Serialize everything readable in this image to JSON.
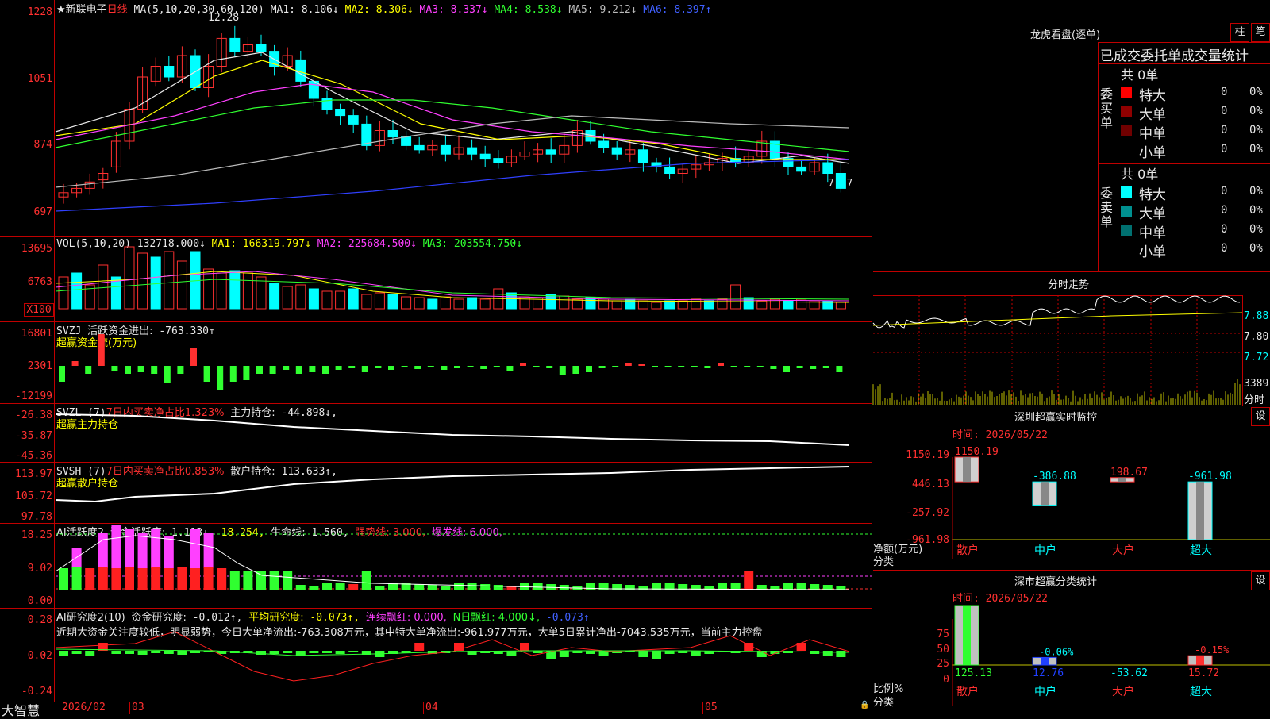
{
  "main": {
    "stock_name": "★新联电子",
    "period": "日线",
    "ma_label": "MA(5,10,20,30,60,120)",
    "ma": [
      {
        "name": "MA1:",
        "value": "8.106↓",
        "color": "#e8e8e8"
      },
      {
        "name": "MA2:",
        "value": "8.306↓",
        "color": "#ffff00"
      },
      {
        "name": "MA3:",
        "value": "8.337↓",
        "color": "#ff40ff"
      },
      {
        "name": "MA4:",
        "value": "8.538↓",
        "color": "#30ff30"
      },
      {
        "name": "MA5:",
        "value": "9.212↓",
        "color": "#bbbbbb"
      },
      {
        "name": "MA6:",
        "value": "8.397↑",
        "color": "#4060ff"
      }
    ],
    "axis": [
      "1228",
      "1051",
      "874",
      "697"
    ],
    "high_mark": "12.28",
    "low_mark": "7.77"
  },
  "vol": {
    "label": "VOL(5,10,20)",
    "value": "132718.000↓",
    "ma": [
      {
        "name": "MA1:",
        "value": "166319.797↓",
        "color": "#ffff00"
      },
      {
        "name": "MA2:",
        "value": "225684.500↓",
        "color": "#ff40ff"
      },
      {
        "name": "MA3:",
        "value": "203554.750↓",
        "color": "#30ff30"
      }
    ],
    "axis": [
      "13695",
      "6763",
      "X100"
    ]
  },
  "svzj": {
    "label": "SVZJ",
    "item": "活跃资金进出:",
    "value": "-763.330↑",
    "subtitle": "超赢资金流(万元)",
    "axis": [
      "16801",
      "2301",
      "-12199"
    ]
  },
  "svzl": {
    "label": "SVZL (7)",
    "item1": "7日内买卖净占比1.323%",
    "item2": "主力持仓:",
    "value": "-44.898↓,",
    "subtitle": "超赢主力持仓",
    "axis": [
      "-26.38",
      "-35.87",
      "-45.36"
    ]
  },
  "svsh": {
    "label": "SVSH (7)",
    "item1": "7日内买卖净占比0.853%",
    "item2": "散户持仓:",
    "value": "113.633↑,",
    "subtitle": "超赢散户持仓",
    "axis": [
      "113.97",
      "105.72",
      "97.78"
    ]
  },
  "ai1": {
    "label": "AI活跃度2",
    "item": "资金活跃度:",
    "value": "1.113↓,",
    "v2": "18.254,",
    "life_label": "生命线:",
    "life": "1.560,",
    "strong": "强势线: 3.000,",
    "burst": "爆发线: 6.000,",
    "axis": [
      "18.25",
      "9.02",
      "0.00"
    ]
  },
  "ai2": {
    "label": "AI研究度2(10)",
    "item1": "资金研究度:",
    "v1": "-0.012↑,",
    "item2": "平均研究度:",
    "v2": "-0.073↑,",
    "item3": "连续飘红: 0.000,",
    "item4": "N日飘红: 4.000↓,",
    "v5": "-0.073↑",
    "comment": "近期大资金关注度较低，明显弱势，今日大单净流出:-763.308万元，其中特大单净流出:-961.977万元，大单5日累计净出-7043.535万元，当前主力控盘",
    "axis": [
      "0.28",
      "0.02",
      "-0.24"
    ]
  },
  "timeline": {
    "brand": "大智慧",
    "labels": [
      "2026/02",
      "03",
      "04",
      "05"
    ]
  },
  "right": {
    "longhu_title": "龙虎看盘(逐单)",
    "btn1": "柱",
    "btn2": "笔",
    "table_title": "已成交委托单成交量统计",
    "buy": {
      "side": "委买单",
      "total": "共 0单",
      "rows": [
        {
          "name": "特大",
          "v": "0",
          "p": "0%",
          "color": "#ff0000"
        },
        {
          "name": "大单",
          "v": "0",
          "p": "0%",
          "color": "#900000"
        },
        {
          "name": "中单",
          "v": "0",
          "p": "0%",
          "color": "#700000"
        },
        {
          "name": "小单",
          "v": "0",
          "p": "0%",
          "color": "#000000"
        }
      ]
    },
    "sell": {
      "side": "委卖单",
      "total": "共 0单",
      "rows": [
        {
          "name": "特大",
          "v": "0",
          "p": "0%",
          "color": "#00ffff"
        },
        {
          "name": "大单",
          "v": "0",
          "p": "0%",
          "color": "#009090"
        },
        {
          "name": "中单",
          "v": "0",
          "p": "0%",
          "color": "#007070"
        },
        {
          "name": "小单",
          "v": "0",
          "p": "0%",
          "color": "#000000"
        }
      ]
    },
    "fenshi": {
      "title": "分时走势",
      "axis": [
        "7.88",
        "7.80",
        "7.72"
      ],
      "vol": "3389",
      "vol_unit": "分时"
    },
    "monitor": {
      "title": "深圳超赢实时监控",
      "set": "设",
      "time": "时间: 2026/05/22",
      "axis": [
        "1150.19",
        "446.13",
        "-257.92",
        "-961.98"
      ],
      "unit": "净额(万元)",
      "cat_label": "分类",
      "bars": [
        {
          "cat": "散户",
          "value": 1150.19,
          "label": "1150.19"
        },
        {
          "cat": "中户",
          "value": -386.88,
          "label": "-386.88"
        },
        {
          "cat": "大户",
          "value": 198.67,
          "label": "198.67"
        },
        {
          "cat": "超大",
          "value": -961.98,
          "label": "-961.98"
        }
      ]
    },
    "stat": {
      "title": "深市超赢分类统计",
      "set": "设",
      "time": "时间: 2026/05/22",
      "axis": [
        "75",
        "50",
        "25",
        "0"
      ],
      "unit": "比例%",
      "cat_label": "分类",
      "bars": [
        {
          "cat": "散户",
          "value": 125.13,
          "label": "125.13",
          "pct": ""
        },
        {
          "cat": "中户",
          "value": 12.76,
          "label": "12.76",
          "pct": "-0.06%"
        },
        {
          "cat": "大户",
          "value": -53.62,
          "label": "-53.62",
          "pct": ""
        },
        {
          "cat": "超大",
          "value": 15.72,
          "label": "15.72",
          "pct": "-0.15%"
        }
      ]
    }
  }
}
